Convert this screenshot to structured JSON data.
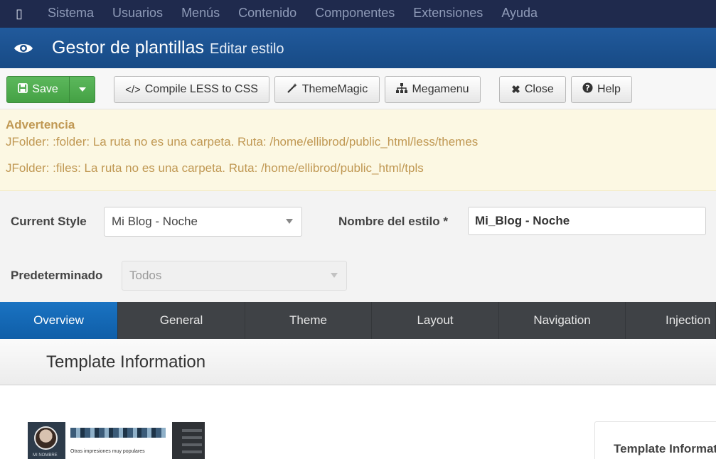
{
  "topbar": {
    "menu": [
      "Sistema",
      "Usuarios",
      "Menús",
      "Contenido",
      "Componentes",
      "Extensiones",
      "Ayuda"
    ]
  },
  "header": {
    "title": "Gestor de plantillas",
    "subtitle": "Editar estilo"
  },
  "toolbar": {
    "save_label": "Save",
    "compile_label": "Compile LESS to CSS",
    "thememagic_label": "ThemeMagic",
    "megamenu_label": "Megamenu",
    "close_label": "Close",
    "help_label": "Help"
  },
  "warning": {
    "title": "Advertencia",
    "messages": [
      "JFolder: :folder: La ruta no es una carpeta. Ruta: /home/ellibrod/public_html/less/themes",
      "JFolder: :files: La ruta no es una carpeta. Ruta: /home/ellibrod/public_html/tpls"
    ]
  },
  "form": {
    "current_style_label": "Current Style",
    "current_style_value": "Mi Blog - Noche",
    "style_name_label": "Nombre del estilo *",
    "style_name_value": "Mi_Blog - Noche",
    "default_label": "Predeterminado",
    "default_value": "Todos"
  },
  "tabs": [
    "Overview",
    "General",
    "Theme",
    "Layout",
    "Navigation",
    "Injection"
  ],
  "active_tab": "Overview",
  "section": {
    "title": "Template Information"
  },
  "preview": {
    "profile_name": "MI NOMBRE",
    "caption": "Otras impresiones muy populares"
  },
  "info_card": {
    "title": "Template Information"
  },
  "colors": {
    "topbar": "#1f2a4d",
    "titlebar": "#1c4f8c",
    "save_green": "#4cae4c",
    "warning_bg": "#fcf8e3",
    "warning_text": "#c09853",
    "tab_active": "#1469b5",
    "tab_bg": "#3f4246"
  },
  "icons": {
    "joomla": "joomla-logo-icon",
    "eye": "eye-icon",
    "save": "floppy-icon",
    "dropdown": "caret-down-icon",
    "compile": "code-icon",
    "magic": "magic-wand-icon",
    "megamenu": "sitemap-icon",
    "close": "x-icon",
    "help": "question-circle-icon"
  }
}
